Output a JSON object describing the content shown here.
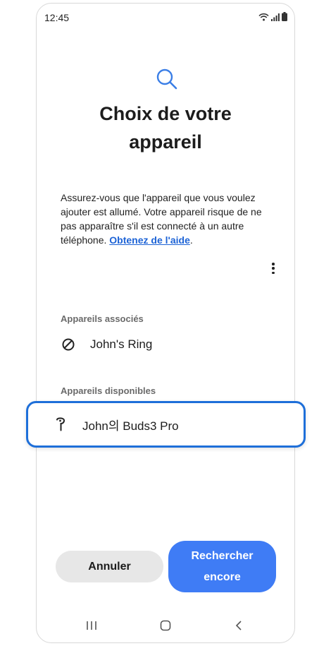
{
  "status_bar": {
    "time": "12:45",
    "icons": [
      "wifi-icon",
      "signal-icon",
      "battery-icon"
    ]
  },
  "header": {
    "icon": "search-icon",
    "title": "Choix de votre appareil"
  },
  "description": {
    "text": "Assurez-vous que l'appareil que vous voulez ajouter est allumé. Votre appareil risque de ne pas apparaître s'il est connecté à un autre téléphone. ",
    "link": "Obtenez de l'aide",
    "suffix": "."
  },
  "more_options": {
    "icon": "more-vert-icon"
  },
  "paired_section": {
    "header": "Appareils associés",
    "items": [
      {
        "label": "John's Ring",
        "icon": "ring-icon"
      }
    ]
  },
  "available_section": {
    "header": "Appareils disponibles",
    "items": [
      {
        "label": "John의 Buds3 Pro",
        "icon": "earbud-icon"
      }
    ]
  },
  "buttons": {
    "cancel": "Annuler",
    "search_again": "Rechercher encore"
  },
  "nav_bar": {
    "icons": [
      "recent-apps-icon",
      "home-icon",
      "back-icon"
    ]
  },
  "colors": {
    "accent": "#3f7cf5",
    "highlight_border": "#1e6fd9",
    "link": "#1d63d6"
  }
}
